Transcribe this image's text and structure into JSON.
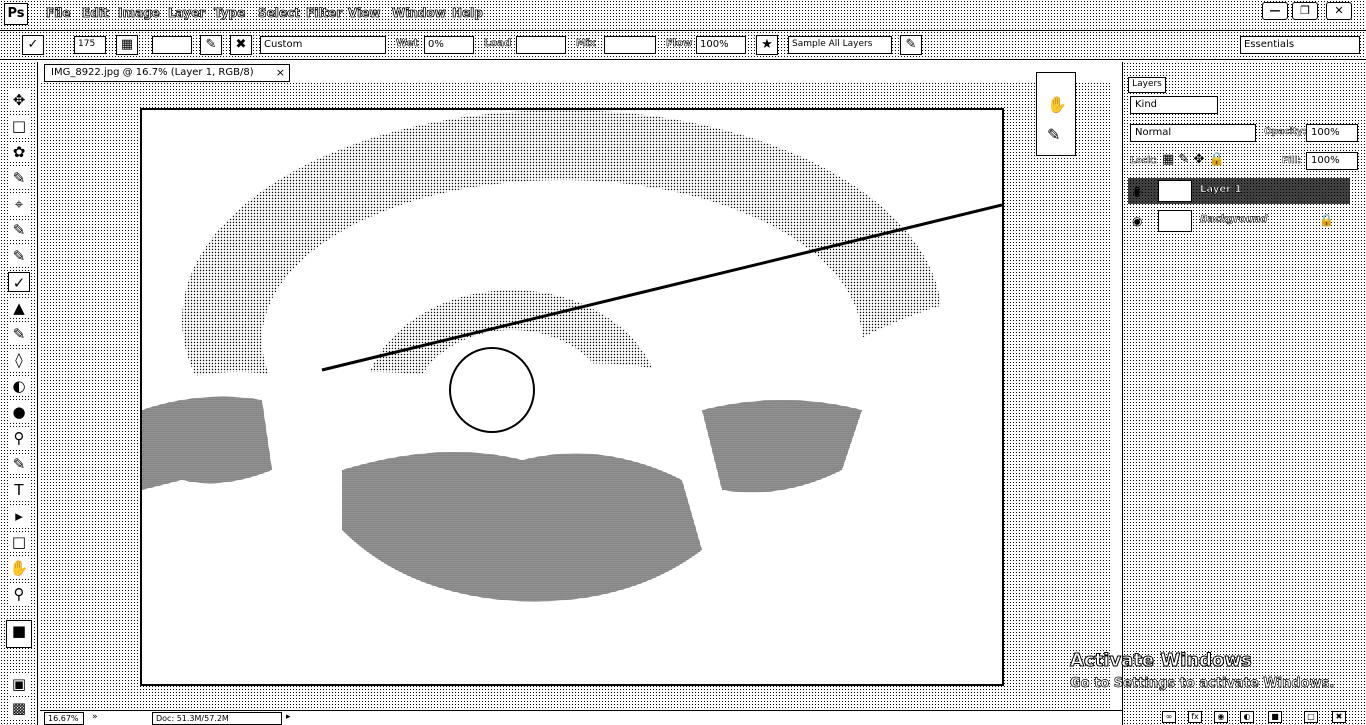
{
  "app": {
    "logo": "Ps"
  },
  "menu": [
    "File",
    "Edit",
    "Image",
    "Layer",
    "Type",
    "Select",
    "Filter",
    "View",
    "Window",
    "Help"
  ],
  "options": {
    "brush_size": "175",
    "preset": "Custom",
    "wet_label": "Wet",
    "wet_value": "0%",
    "load_label": "Load",
    "load_value": "",
    "mix_label": "Mix",
    "flow_label": "Flow",
    "flow_value": "100%",
    "sample_all_layers": "Sample All Layers",
    "workspace": "Essentials"
  },
  "document": {
    "tab_title": "IMG_8922.jpg @ 16.7% (Layer 1, RGB/8)",
    "zoom": "16.67%",
    "doc_info": "Doc: 51.3M/57.2M"
  },
  "layers_panel": {
    "tab": "Layers",
    "kind": "Kind",
    "blend_mode": "Normal",
    "opacity_label": "Opacity:",
    "opacity": "100%",
    "lock_label": "Lock:",
    "fill_label": "Fill:",
    "fill": "100%",
    "layers": [
      {
        "name": "Layer 1",
        "selected": true
      },
      {
        "name": "Background",
        "selected": false
      }
    ]
  },
  "watermark": {
    "title": "Activate Windows",
    "subtitle": "Go to Settings to activate Windows."
  }
}
